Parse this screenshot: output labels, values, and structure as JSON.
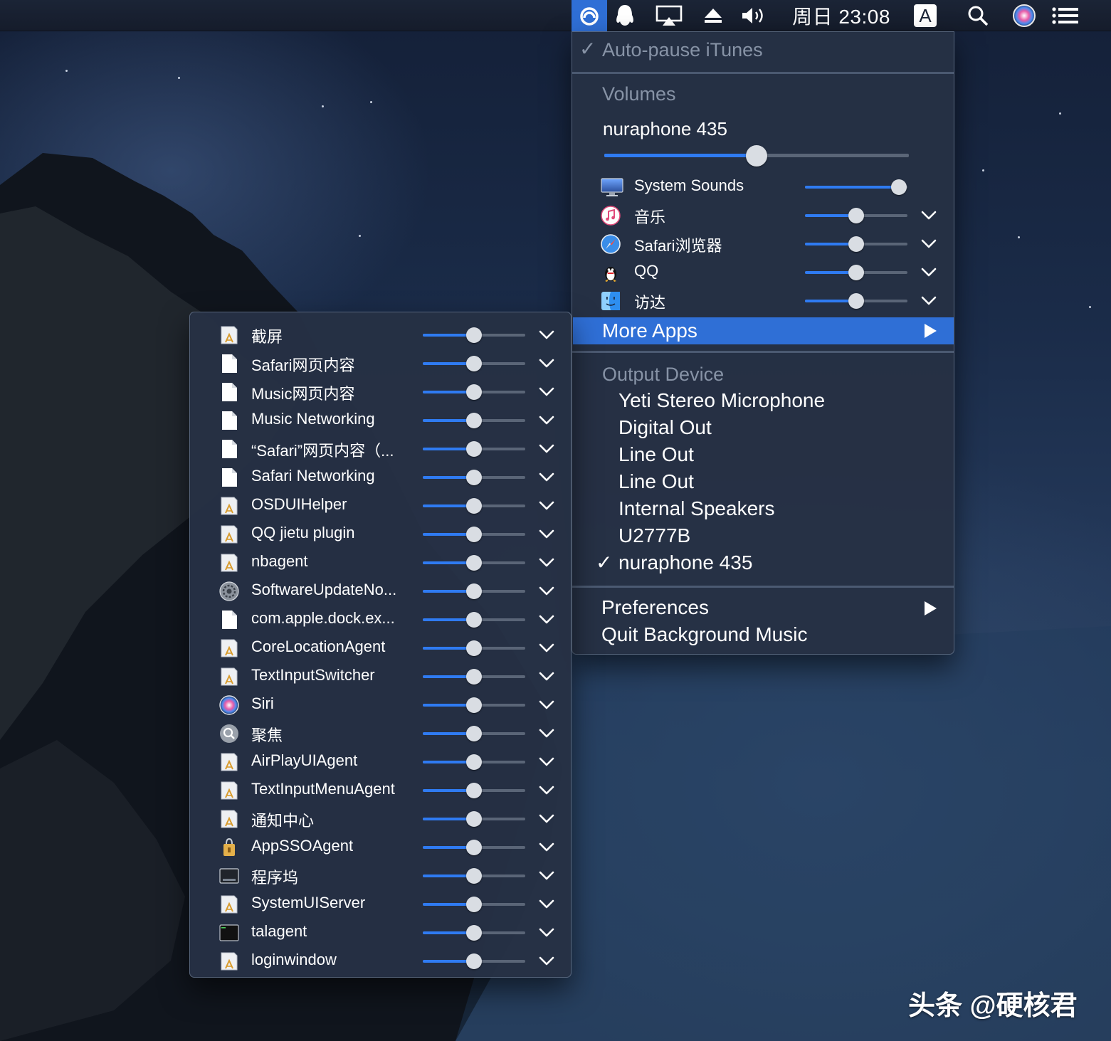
{
  "menubar": {
    "icons": [
      "background-music-icon",
      "qq-penguin-icon",
      "airplay-icon",
      "eject-icon",
      "volume-icon",
      "input-source-icon",
      "spotlight-icon",
      "siri-icon",
      "notification-center-icon"
    ],
    "clock": "周日 23:08",
    "input_source_letter": "A"
  },
  "main_menu": {
    "auto_pause_label": "Auto-pause iTunes",
    "volumes_header": "Volumes",
    "device_name": "nuraphone 435",
    "device_volume": 0.5,
    "apps": [
      {
        "name": "System Sounds",
        "icon": "display-icon",
        "volume": 0.92,
        "expandable": false
      },
      {
        "name": "音乐",
        "icon": "music-app-icon",
        "volume": 0.5,
        "expandable": true
      },
      {
        "name": "Safari浏览器",
        "icon": "safari-icon",
        "volume": 0.5,
        "expandable": true
      },
      {
        "name": "QQ",
        "icon": "qq-icon",
        "volume": 0.5,
        "expandable": true
      },
      {
        "name": "访达",
        "icon": "finder-icon",
        "volume": 0.5,
        "expandable": true
      }
    ],
    "more_apps_label": "More Apps",
    "output_header": "Output Device",
    "output_devices": [
      {
        "name": "Yeti Stereo Microphone",
        "selected": false
      },
      {
        "name": "Digital Out",
        "selected": false
      },
      {
        "name": "Line Out",
        "selected": false
      },
      {
        "name": "Line Out",
        "selected": false
      },
      {
        "name": "Internal Speakers",
        "selected": false
      },
      {
        "name": "U2777B",
        "selected": false
      },
      {
        "name": "nuraphone 435",
        "selected": true
      }
    ],
    "preferences_label": "Preferences",
    "quit_label": "Quit Background Music",
    "checkmark": "✓"
  },
  "more_apps_menu": {
    "apps": [
      {
        "name": "截屏",
        "icon": "generic-app-icon",
        "volume": 0.5
      },
      {
        "name": "Safari网页内容",
        "icon": "document-icon",
        "volume": 0.5
      },
      {
        "name": "Music网页内容",
        "icon": "document-icon",
        "volume": 0.5
      },
      {
        "name": "Music Networking",
        "icon": "document-icon",
        "volume": 0.5
      },
      {
        "name": "“Safari”网页内容（...",
        "icon": "document-icon",
        "volume": 0.5
      },
      {
        "name": "Safari Networking",
        "icon": "document-icon",
        "volume": 0.5
      },
      {
        "name": "OSDUIHelper",
        "icon": "generic-app-icon",
        "volume": 0.5
      },
      {
        "name": "QQ jietu plugin",
        "icon": "generic-app-icon",
        "volume": 0.5
      },
      {
        "name": "nbagent",
        "icon": "generic-app-icon",
        "volume": 0.5
      },
      {
        "name": "SoftwareUpdateNo...",
        "icon": "gear-icon",
        "volume": 0.5
      },
      {
        "name": "com.apple.dock.ex...",
        "icon": "document-icon",
        "volume": 0.5
      },
      {
        "name": "CoreLocationAgent",
        "icon": "generic-app-icon",
        "volume": 0.5
      },
      {
        "name": "TextInputSwitcher",
        "icon": "generic-app-icon",
        "volume": 0.5
      },
      {
        "name": "Siri",
        "icon": "siri-icon",
        "volume": 0.5
      },
      {
        "name": "聚焦",
        "icon": "spotlight-icon",
        "volume": 0.5
      },
      {
        "name": "AirPlayUIAgent",
        "icon": "generic-app-icon",
        "volume": 0.5
      },
      {
        "name": "TextInputMenuAgent",
        "icon": "generic-app-icon",
        "volume": 0.5
      },
      {
        "name": "通知中心",
        "icon": "generic-app-icon",
        "volume": 0.5
      },
      {
        "name": "AppSSOAgent",
        "icon": "keychain-icon",
        "volume": 0.5
      },
      {
        "name": "程序坞",
        "icon": "dock-icon",
        "volume": 0.5
      },
      {
        "name": "SystemUIServer",
        "icon": "generic-app-icon",
        "volume": 0.5
      },
      {
        "name": "talagent",
        "icon": "terminal-icon",
        "volume": 0.5
      },
      {
        "name": "loginwindow",
        "icon": "generic-app-icon",
        "volume": 0.5
      }
    ]
  },
  "watermark": "头条 @硬核君",
  "colors": {
    "accent": "#2f6fd6",
    "slider_fill": "#2f7bf2",
    "menu_bg": "#263144",
    "disabled_text": "#8793a6"
  }
}
